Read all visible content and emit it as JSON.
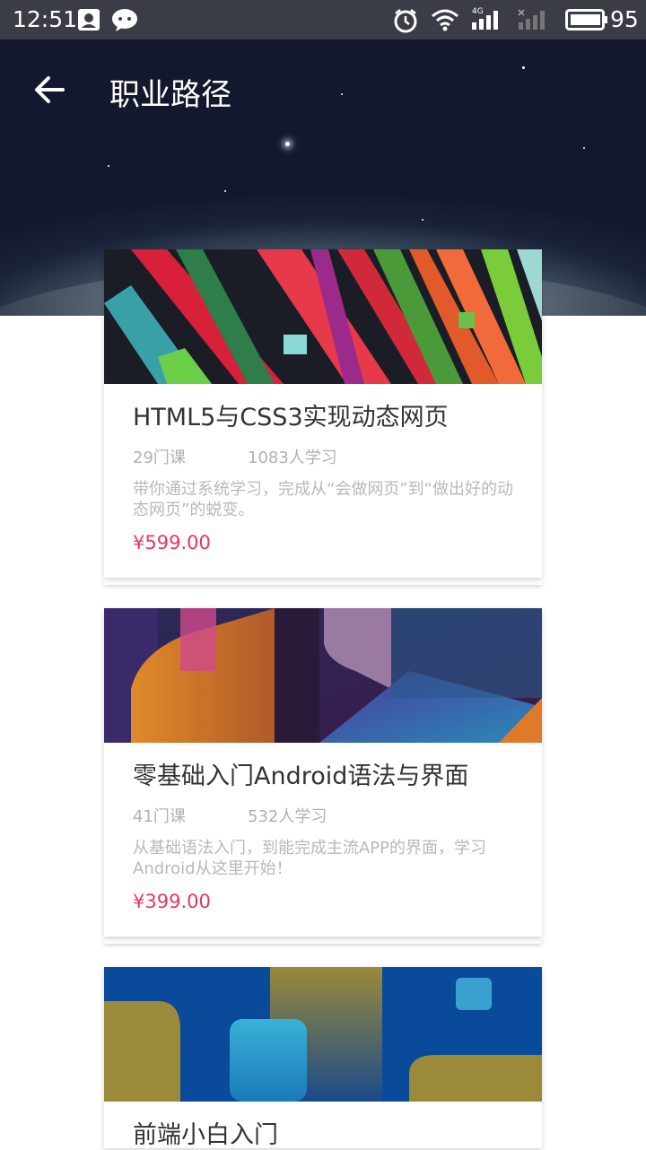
{
  "status_bar": {
    "time": "12:51",
    "battery": "95",
    "network": "4G",
    "icons": [
      "qq-icon",
      "wechat-icon",
      "alarm-icon",
      "wifi-icon",
      "signal-icon",
      "battery-icon"
    ]
  },
  "header": {
    "title": "职业路径",
    "back_icon": "arrow-left-icon"
  },
  "courses": [
    {
      "title": "HTML5与CSS3实现动态网页",
      "lessons": "29门课",
      "learners": "1083人学习",
      "description": "带你通过系统学习，完成从“会做网页”到“做出好的动态网页”的蜕变。",
      "price": "¥599.00"
    },
    {
      "title": "零基础入门Android语法与界面",
      "lessons": "41门课",
      "learners": "532人学习",
      "description": "从基础语法入门，到能完成主流APP的界面，学习Android从这里开始！",
      "price": "¥399.00"
    },
    {
      "title": "前端小白入门"
    }
  ],
  "colors": {
    "price": "#e8375a",
    "status_bar": "#3a3d45",
    "meta_text": "#b0b0b0"
  }
}
